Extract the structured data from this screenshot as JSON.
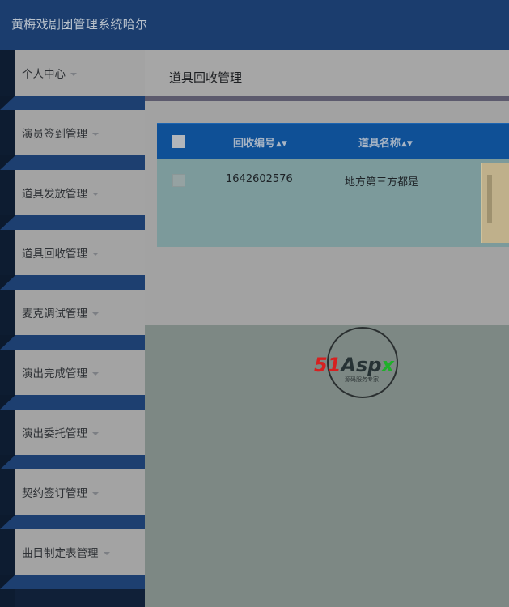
{
  "app": {
    "title": "黄梅戏剧团管理系统哈尔"
  },
  "sidebar": {
    "items": [
      {
        "label": "个人中心"
      },
      {
        "label": "演员签到管理"
      },
      {
        "label": "道具发放管理"
      },
      {
        "label": "道具回收管理"
      },
      {
        "label": "麦克调试管理"
      },
      {
        "label": "演出完成管理"
      },
      {
        "label": "演出委托管理"
      },
      {
        "label": "契约签订管理"
      },
      {
        "label": "曲目制定表管理"
      }
    ]
  },
  "page": {
    "title": "道具回收管理"
  },
  "table": {
    "columns": [
      {
        "label": "回收编号"
      },
      {
        "label": "道具名称"
      }
    ],
    "rows": [
      {
        "id": "1642602576",
        "name": "地方第三方都是"
      }
    ]
  },
  "watermark": {
    "brand": "51Aspx",
    "subtitle": "源码服务专家"
  },
  "colors": {
    "header": "#1b3d6e",
    "table_header": "#0f5096",
    "sidebar_band": "#1d3f70",
    "logo_red": "#d62020",
    "logo_green": "#1fb02a"
  },
  "icons": {
    "sort": "sort-icon",
    "caret": "chevron-down-icon"
  }
}
